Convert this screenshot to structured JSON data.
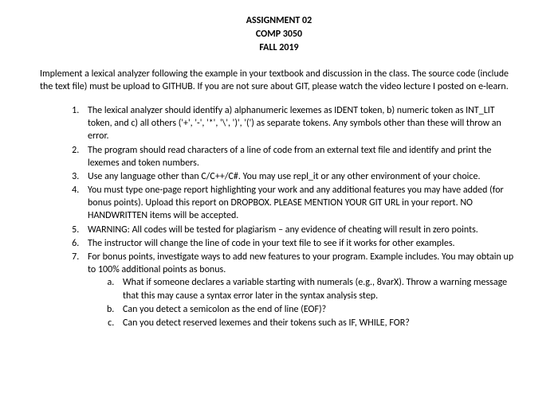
{
  "header": {
    "line1": "ASSIGNMENT 02",
    "line2": "COMP 3050",
    "line3": "FALL 2019"
  },
  "intro": "Implement a lexical analyzer following the example in your textbook and discussion in the class. The source code (include the text file) must be upload to GITHUB. If you are not sure about GIT, please watch the video lecture I posted on e-learn.",
  "items": [
    "The lexical analyzer should identify a) alphanumeric lexemes as IDENT token, b) numeric token as INT_LIT token, and c) all others ('+', '-', '*', '\\', ')', '(') as separate tokens. Any symbols other than these will throw an error.",
    "The program should read characters of a line of code from an external text file and identify and print the lexemes and token numbers.",
    "Use any language other than C/C++/C#. You may use repl_it or any other environment of your choice.",
    "You must type one-page report highlighting your work and any additional features you may have added (for bonus points). Upload this report on DROPBOX. PLEASE MENTION YOUR GIT URL in your report. NO HANDWRITTEN items will be accepted.",
    "WARNING: All codes will be tested for plagiarism – any evidence of cheating will result in zero points.",
    "The instructor will change the line of code in your text file to see if it works for other examples.",
    "For bonus points, investigate ways to add new features to your program. Example includes. You may obtain up to 100% additional points as bonus."
  ],
  "subitems": [
    "What if someone declares a variable starting with numerals (e.g., 8varX). Throw a warning message that this may cause a syntax error later in the syntax analysis step.",
    "Can you detect a semicolon as the end of line (EOF)?",
    "Can you detect reserved lexemes and their tokens such as IF, WHILE, FOR?"
  ]
}
